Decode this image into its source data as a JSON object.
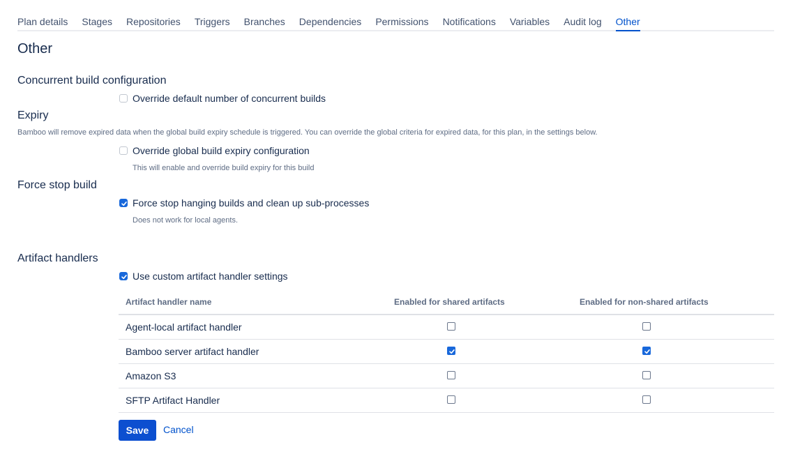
{
  "tabs": [
    {
      "label": "Plan details"
    },
    {
      "label": "Stages"
    },
    {
      "label": "Repositories"
    },
    {
      "label": "Triggers"
    },
    {
      "label": "Branches"
    },
    {
      "label": "Dependencies"
    },
    {
      "label": "Permissions"
    },
    {
      "label": "Notifications"
    },
    {
      "label": "Variables"
    },
    {
      "label": "Audit log"
    },
    {
      "label": "Other",
      "active": true
    }
  ],
  "page": {
    "title": "Other"
  },
  "concurrent": {
    "title": "Concurrent build configuration",
    "override_label": "Override default number of concurrent builds",
    "override_checked": false
  },
  "expiry": {
    "title": "Expiry",
    "description": "Bamboo will remove expired data when the global build expiry schedule is triggered. You can override the global criteria for expired data, for this plan, in the settings below.",
    "override_label": "Override global build expiry configuration",
    "override_checked": false,
    "override_help": "This will enable and override build expiry for this build"
  },
  "force_stop": {
    "title": "Force stop build",
    "label": "Force stop hanging builds and clean up sub-processes",
    "checked": true,
    "help": "Does not work for local agents."
  },
  "artifacts": {
    "title": "Artifact handlers",
    "custom_label": "Use custom artifact handler settings",
    "custom_checked": true,
    "columns": [
      "Artifact handler name",
      "Enabled for shared artifacts",
      "Enabled for non-shared artifacts"
    ],
    "rows": [
      {
        "name": "Agent-local artifact handler",
        "shared": false,
        "non_shared": false
      },
      {
        "name": "Bamboo server artifact handler",
        "shared": true,
        "non_shared": true
      },
      {
        "name": "Amazon S3",
        "shared": false,
        "non_shared": false
      },
      {
        "name": "SFTP Artifact Handler",
        "shared": false,
        "non_shared": false
      }
    ]
  },
  "actions": {
    "save_label": "Save",
    "cancel_label": "Cancel"
  }
}
